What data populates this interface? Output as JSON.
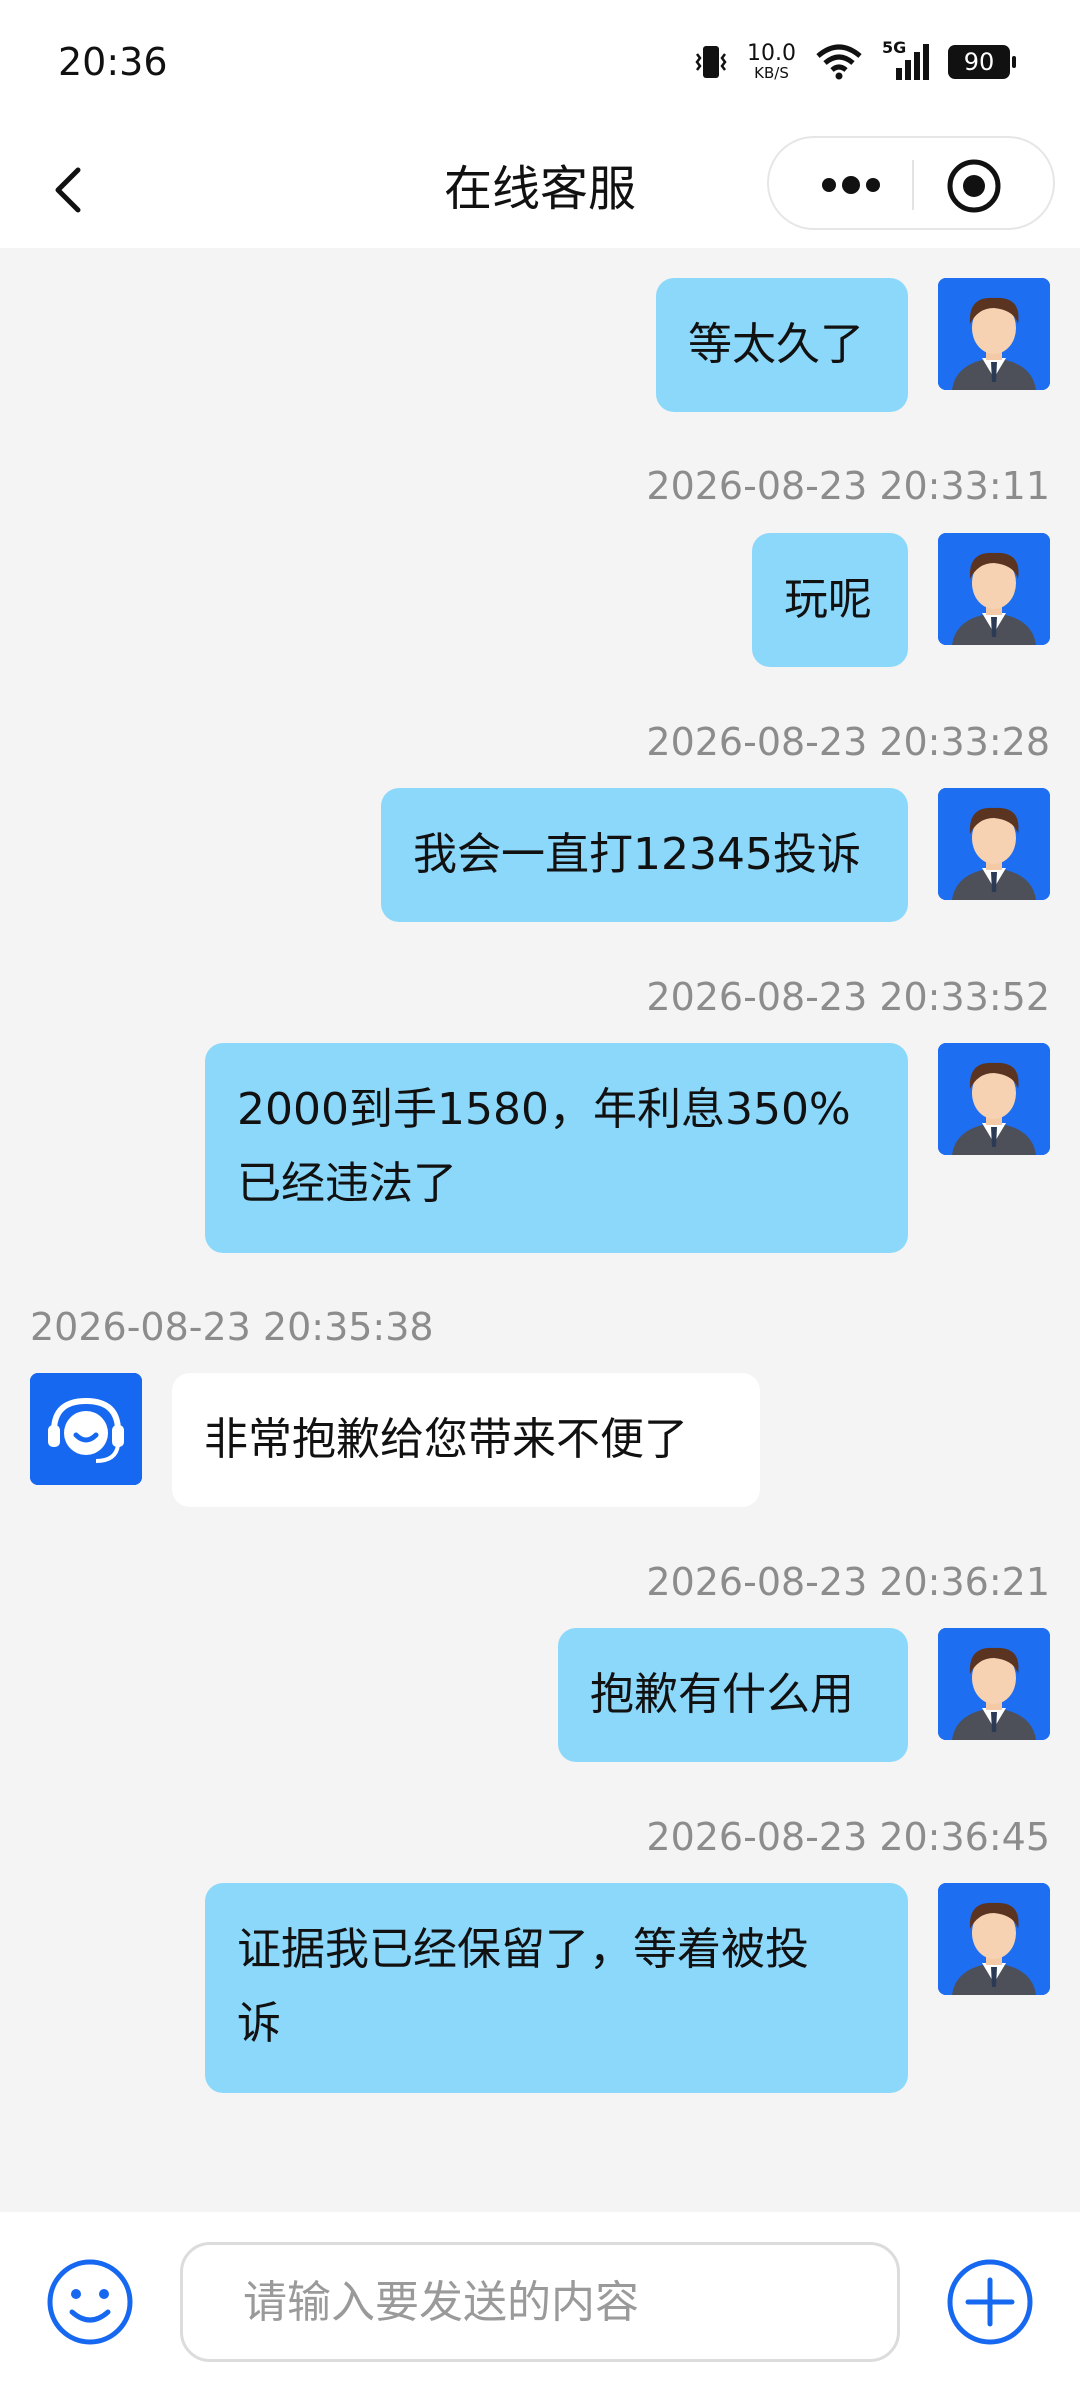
{
  "status_bar": {
    "time": "20:36",
    "net_speed_value": "10.0",
    "net_speed_unit": "KB/S",
    "network": "5G",
    "battery": "90"
  },
  "nav": {
    "title": "在线客服",
    "icons": [
      "back-chevron-icon",
      "more-dots-icon",
      "target-icon"
    ]
  },
  "messages": [
    {
      "from": "user",
      "text": "等太久了"
    },
    {
      "from": "user",
      "time": "2026-08-23 20:33:11",
      "text": "玩呢"
    },
    {
      "from": "user",
      "time": "2026-08-23 20:33:28",
      "text": "我会一直打12345投诉"
    },
    {
      "from": "user",
      "time": "2026-08-23 20:33:52",
      "line1": "2000到手1580，年利息350%",
      "line2": "已经违法了"
    },
    {
      "from": "agent",
      "time": "2026-08-23 20:35:38",
      "text": "非常抱歉给您带来不便了"
    },
    {
      "from": "user",
      "time": "2026-08-23 20:36:21",
      "text": "抱歉有什么用"
    },
    {
      "from": "user",
      "time": "2026-08-23 20:36:45",
      "line1": "证据我已经保留了，等着被投",
      "line2": "诉"
    }
  ],
  "composer": {
    "placeholder": "请输入要发送的内容",
    "icons": [
      "emoji-smile-icon",
      "plus-circle-icon"
    ]
  },
  "colors": {
    "user_bubble": "#8cd8fb",
    "agent_bubble": "#ffffff",
    "accent_blue": "#1668f0",
    "background": "#f4f4f4"
  }
}
